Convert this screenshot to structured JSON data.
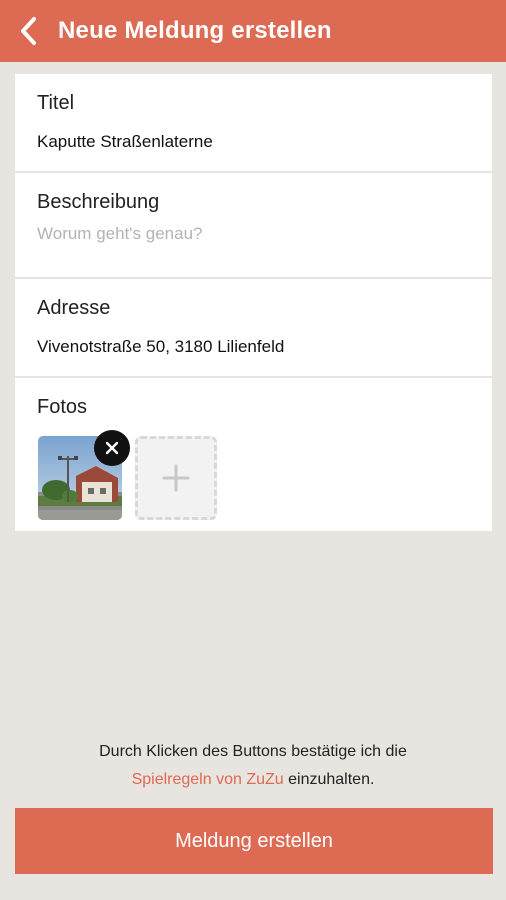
{
  "header": {
    "title": "Neue Meldung erstellen",
    "back_icon": "chevron-left-icon"
  },
  "form": {
    "title_field": {
      "label": "Titel",
      "value": "Kaputte Straßenlaterne"
    },
    "description_field": {
      "label": "Beschreibung",
      "placeholder": "Worum geht's genau?",
      "value": ""
    },
    "address_field": {
      "label": "Adresse",
      "value": "Vivenotstraße 50, 3180 Lilienfeld"
    },
    "photos_field": {
      "label": "Fotos",
      "remove_icon": "close-icon",
      "add_icon": "plus-icon"
    }
  },
  "terms": {
    "line1": "Durch Klicken des Buttons bestätige ich die",
    "link_text": "Spielregeln von ZuZu",
    "line2_suffix": " einzuhalten."
  },
  "submit": {
    "label": "Meldung erstellen"
  },
  "colors": {
    "accent": "#dd6a53",
    "background": "#e8e4df",
    "card": "#ffffff",
    "placeholder": "#b3b3b3"
  }
}
